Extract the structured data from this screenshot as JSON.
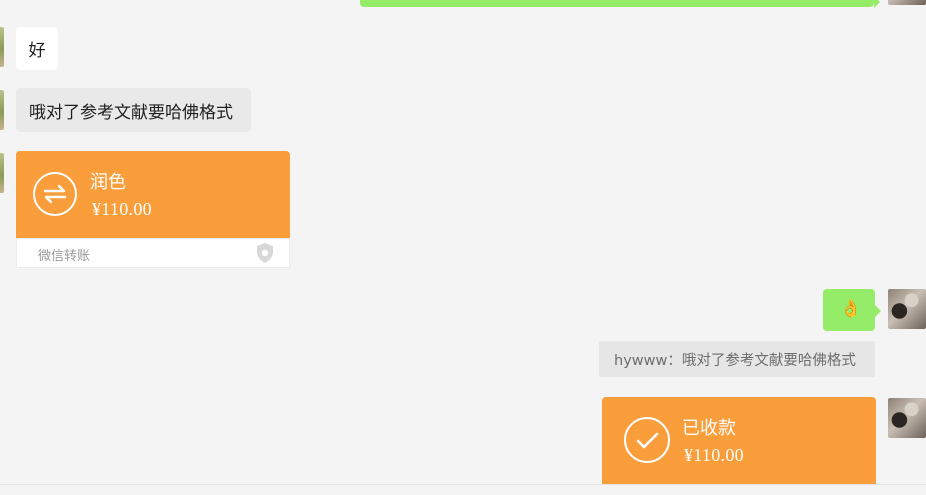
{
  "messages": {
    "msg1_text": "好",
    "msg2_text": "哦对了参考文献要哈佛格式",
    "transfer_in": {
      "note": "润色",
      "amount": "¥110.00",
      "footer": "微信转账"
    },
    "emoji_reply": "👌",
    "quote_text": "hywww：哦对了参考文献要哈佛格式",
    "transfer_out": {
      "status": "已收款",
      "amount": "¥110.00"
    }
  },
  "colors": {
    "background": "#f4f4f4",
    "outgoing_bubble": "#95ec69",
    "transfer_card": "#fa9d3b",
    "incoming_bubble": "#ffffff"
  },
  "icons": [
    "transfer-arrows-icon",
    "shield-icon",
    "checkmark-icon",
    "ok-hand-emoji"
  ]
}
